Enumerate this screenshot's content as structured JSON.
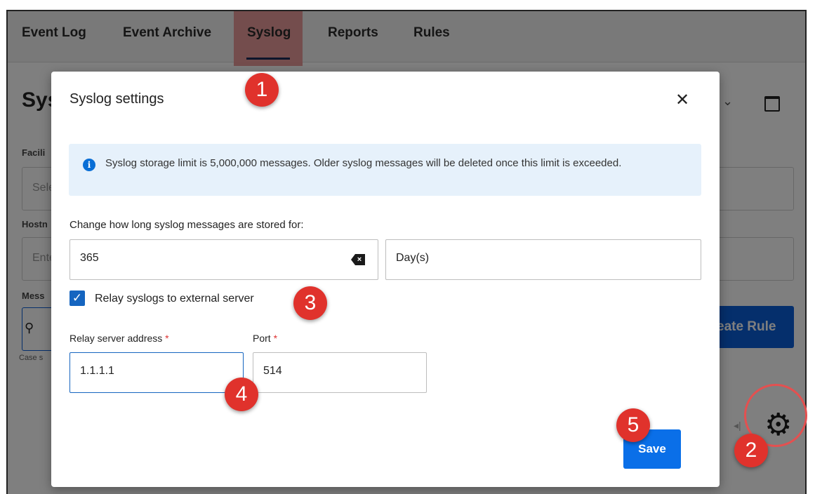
{
  "tabs": [
    "Event Log",
    "Event Archive",
    "Syslog",
    "Reports",
    "Rules"
  ],
  "background": {
    "page_title_partial": "Sys",
    "label_facility": "Facili",
    "placeholder_facility": "Sele",
    "label_hostname": "Hostn",
    "placeholder_hostname": "Ente",
    "label_message": "Mess",
    "case_hint": "Case s",
    "create_rule_partial": "eate Rule"
  },
  "dialog": {
    "title": "Syslog settings",
    "info_text": "Syslog storage limit is 5,000,000 messages. Older syslog messages will be deleted once this limit is exceeded.",
    "retention_label": "Change how long syslog messages are stored for:",
    "retention_value": "365",
    "retention_unit": "Day(s)",
    "relay_checkbox_label": "Relay syslogs to external server",
    "relay_checked": true,
    "relay_address_label": "Relay server address",
    "relay_address_value": "1.1.1.1",
    "port_label": "Port",
    "port_value": "514",
    "required_mark": "*",
    "save_label": "Save"
  },
  "callouts": [
    "1",
    "2",
    "3",
    "4",
    "5"
  ],
  "colors": {
    "primary": "#0a6fe8",
    "callout": "#e0322c",
    "info_bg": "#e6f1fb",
    "tab_highlight": "#e99a9a"
  },
  "icons": {
    "info": "info-circle-icon",
    "close": "close-icon",
    "clear": "backspace-icon",
    "gear": "gear-icon",
    "calendar": "calendar-icon",
    "search": "search-icon"
  }
}
